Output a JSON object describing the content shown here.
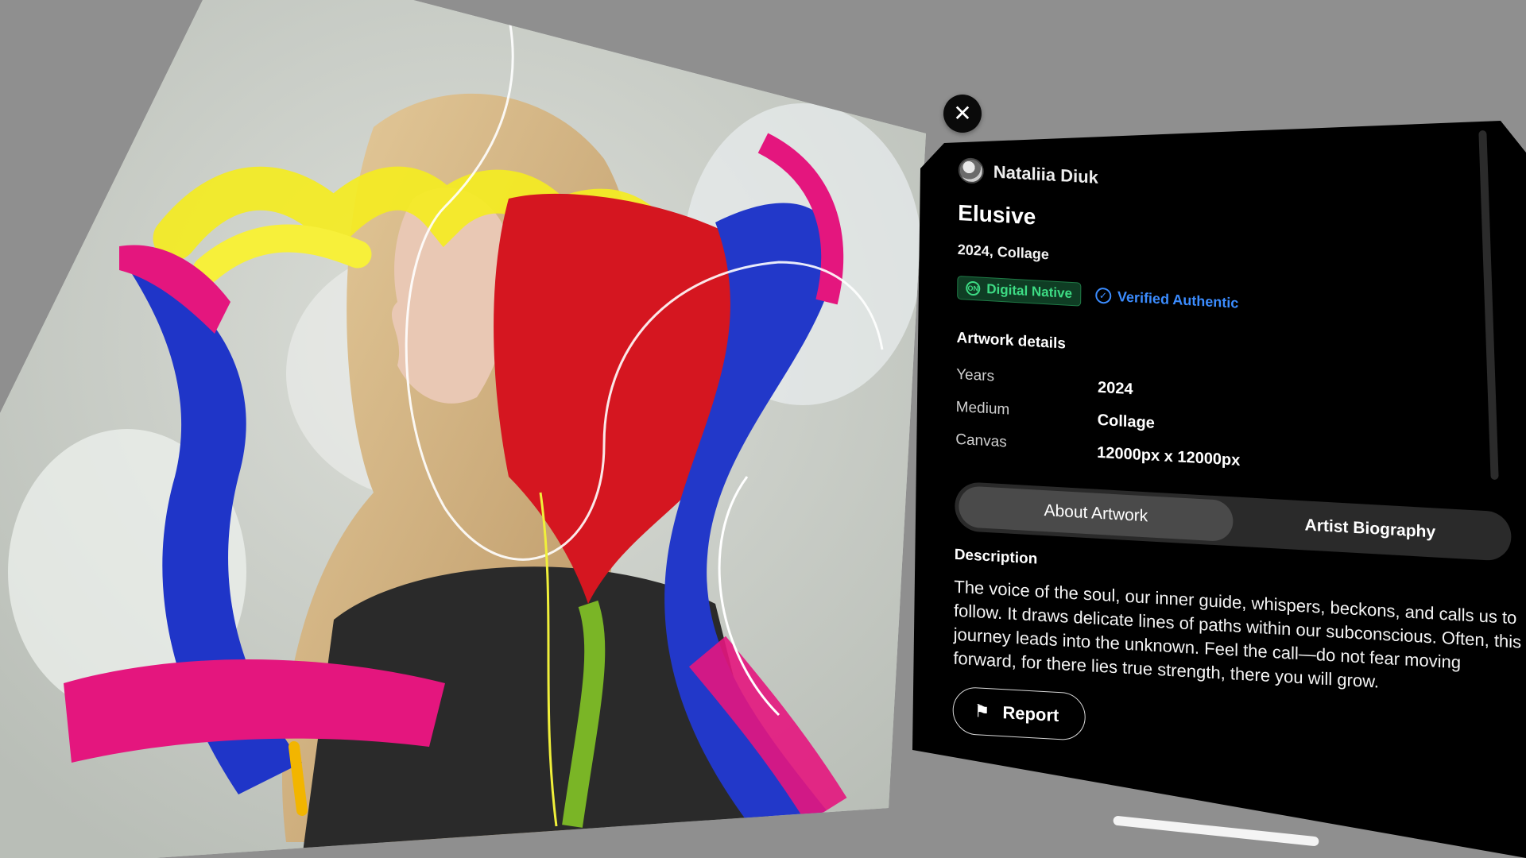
{
  "artwork": {
    "name": "Elusive"
  },
  "panel": {
    "close_label": "✕",
    "artist": {
      "name": "Nataliia Diuk"
    },
    "title": "Elusive",
    "subtitle": "2024, Collage",
    "badges": {
      "native_icon": "ON",
      "native": "Digital Native",
      "verified_icon": "✓",
      "verified": "Verified Authentic"
    },
    "details": {
      "heading": "Artwork details",
      "rows": [
        {
          "label": "Years",
          "value": "2024"
        },
        {
          "label": "Medium",
          "value": "Collage"
        },
        {
          "label": "Canvas",
          "value": "12000px x 12000px"
        }
      ]
    },
    "tabs": [
      {
        "label": "About Artwork",
        "active": true
      },
      {
        "label": "Artist Biography",
        "active": false
      }
    ],
    "description": {
      "heading": "Description",
      "text": "The voice of the soul, our inner guide, whispers, beckons, and calls us to follow. It draws delicate lines of paths within our subconscious. Often, this journey leads into the unknown. Feel the call—do not fear moving forward, for there lies true strength, there you will grow."
    },
    "report": {
      "icon": "⚑",
      "label": "Report"
    }
  },
  "colors": {
    "background": "#8f8f8f",
    "panel": "#000000",
    "native_green": "#3ddc84",
    "verified_blue": "#3b8cff"
  }
}
